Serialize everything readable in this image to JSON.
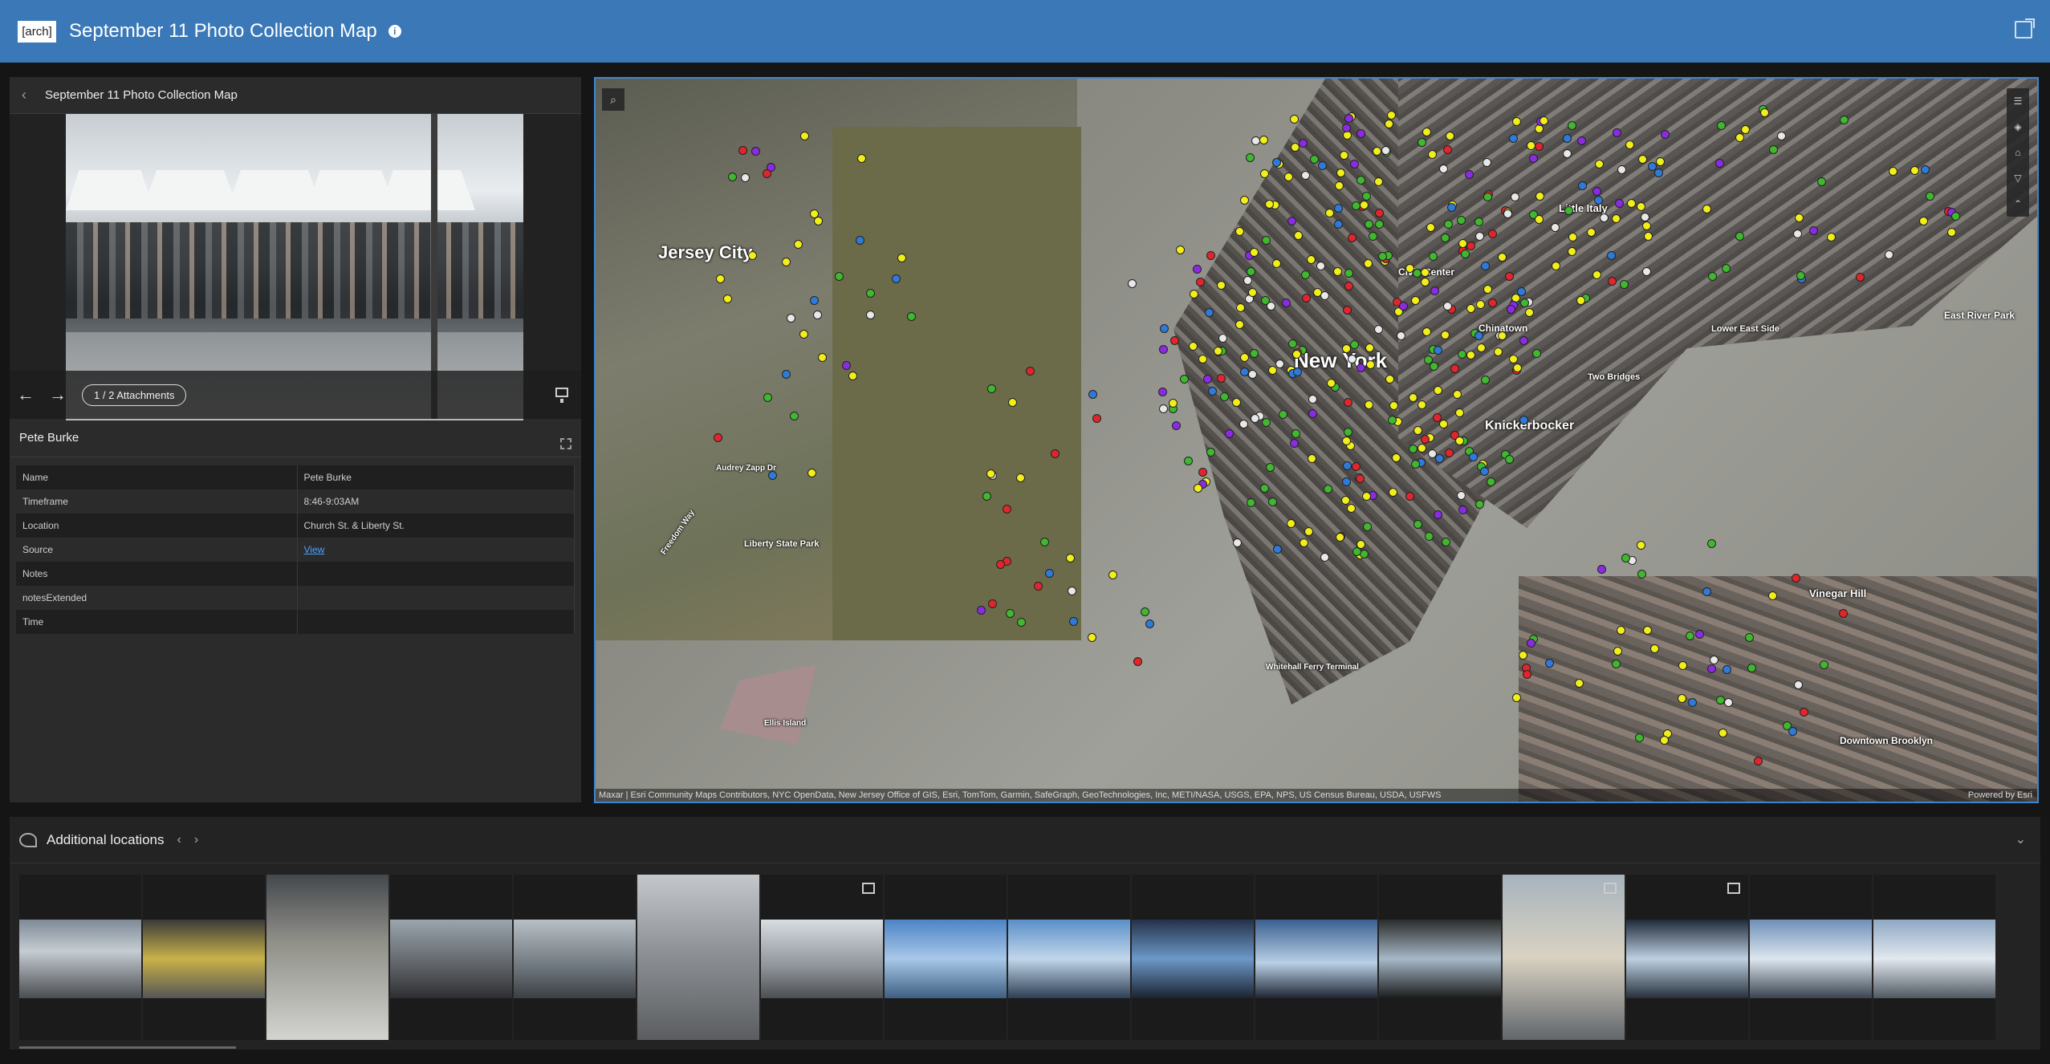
{
  "header": {
    "logo_text": "[arch]",
    "title": "September 11 Photo Collection Map",
    "info_glyph": "i"
  },
  "left_panel": {
    "title": "September 11 Photo Collection Map",
    "attachments_label": "1 / 2 Attachments",
    "feature_name": "Pete Burke",
    "attributes": [
      {
        "key": "Name",
        "value": "Pete Burke"
      },
      {
        "key": "Timeframe",
        "value": "8:46-9:03AM"
      },
      {
        "key": "Location",
        "value": "Church St. & Liberty St."
      },
      {
        "key": "Source",
        "value": "View",
        "is_link": true
      },
      {
        "key": "Notes",
        "value": ""
      },
      {
        "key": "notesExtended",
        "value": ""
      },
      {
        "key": "Time",
        "value": ""
      }
    ]
  },
  "map": {
    "labels": {
      "jersey_city": "Jersey City",
      "new_york": "New York",
      "knickerbocker": "Knickerbocker",
      "east_river_park": "East River Park",
      "vinegar_hill": "Vinegar Hill",
      "downtown_brooklyn": "Downtown Brooklyn",
      "liberty_state_park": "Liberty State Park",
      "ellis_island": "Ellis Island",
      "civic_center": "Civic Center",
      "little_italy": "Little Italy",
      "chinatown": "Chinatown",
      "lower_east_side": "Lower East Side",
      "two_bridges": "Two Bridges",
      "whitehall_ferry": "Whitehall Ferry Terminal",
      "audrey_zapp": "Audrey Zapp Dr",
      "freedom_way": "Freedom Way"
    },
    "attribution": "Maxar | Esri Community Maps Contributors, NYC OpenData, New Jersey Office of GIS, Esri, TomTom, Garmin, SafeGraph, GeoTechnologies, Inc, METI/NASA, USGS, EPA, NPS, US Census Bureau, USDA, USFWS",
    "powered_by": "Powered by Esri",
    "pin_colors": {
      "yellow": "#f2ee1a",
      "green": "#3fb72f",
      "red": "#e0262c",
      "purple": "#8a2be2",
      "white": "#e8e8e8",
      "blue": "#2f7ad8"
    }
  },
  "bottom_panel": {
    "title": "Additional locations",
    "thumbnail_count": 16
  },
  "colors": {
    "header_bg": "#3a78b8",
    "panel_bg": "#2b2b2b",
    "link": "#4fa3ff",
    "map_border": "#3a86d4"
  }
}
